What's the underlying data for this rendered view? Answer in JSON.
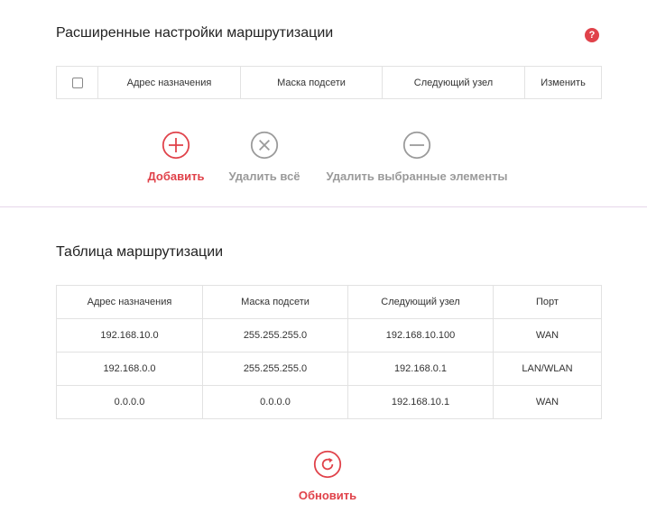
{
  "advanced": {
    "title": "Расширенные настройки маршрутизации",
    "help": "?",
    "columns": [
      "Адрес назначения",
      "Маска подсети",
      "Следующий узел",
      "Изменить"
    ]
  },
  "actions": {
    "add": "Добавить",
    "delete_all": "Удалить всё",
    "delete_selected": "Удалить выбранные элементы"
  },
  "routing_table": {
    "title": "Таблица маршрутизации",
    "columns": [
      "Адрес назначения",
      "Маска подсети",
      "Следующий узел",
      "Порт"
    ],
    "rows": [
      [
        "192.168.10.0",
        "255.255.255.0",
        "192.168.10.100",
        "WAN"
      ],
      [
        "192.168.0.0",
        "255.255.255.0",
        "192.168.0.1",
        "LAN/WLAN"
      ],
      [
        "0.0.0.0",
        "0.0.0.0",
        "192.168.10.1",
        "WAN"
      ]
    ]
  },
  "refresh": {
    "label": "Обновить"
  },
  "colors": {
    "accent": "#e0424a",
    "muted": "#9a9a9a",
    "border": "#e2e2e2"
  },
  "icons": {
    "add": "plus-circle-icon",
    "delete_all": "x-circle-icon",
    "delete_selected": "minus-circle-icon",
    "refresh": "refresh-icon"
  }
}
